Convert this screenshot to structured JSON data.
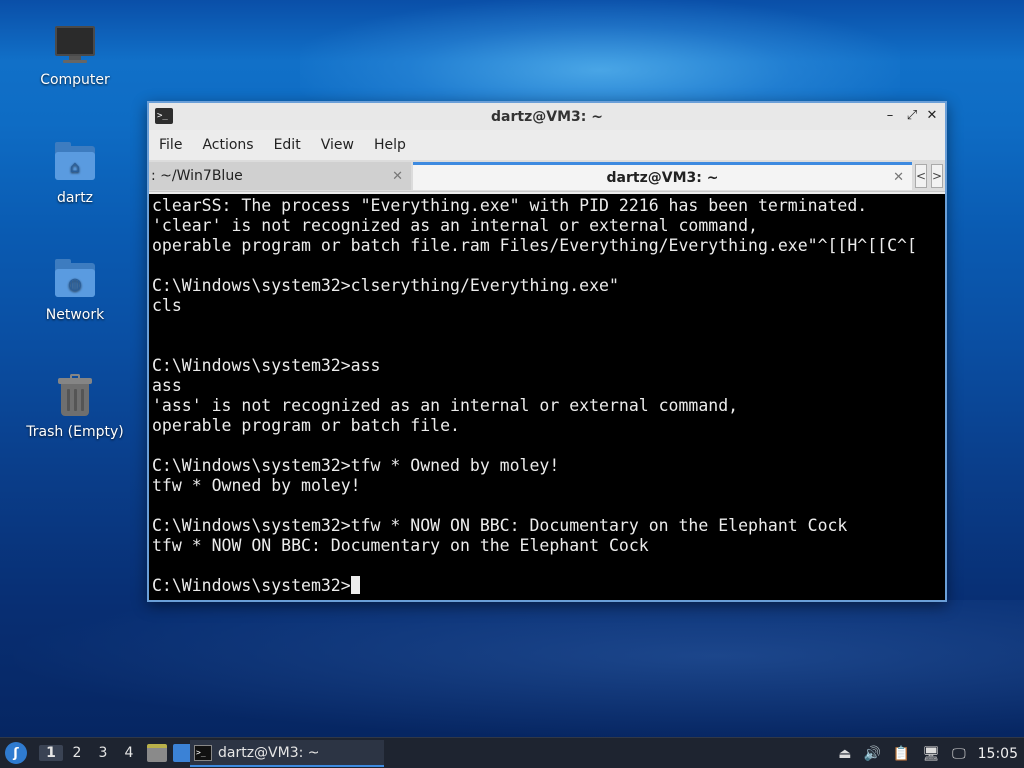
{
  "desktop": {
    "icons": [
      {
        "label": "Computer",
        "icon": "computer-icon"
      },
      {
        "label": "dartz",
        "icon": "home-folder-icon"
      },
      {
        "label": "Network",
        "icon": "network-folder-icon"
      },
      {
        "label": "Trash (Empty)",
        "icon": "trash-icon"
      }
    ]
  },
  "window": {
    "title": "dartz@VM3: ~",
    "menu": [
      "File",
      "Actions",
      "Edit",
      "View",
      "Help"
    ],
    "tabs": [
      {
        "label": ": ~/Win7Blue",
        "active": false
      },
      {
        "label": "dartz@VM3: ~",
        "active": true
      }
    ],
    "tab_scroll_left": "<",
    "tab_scroll_right": ">",
    "terminal_lines": [
      "clearSS: The process \"Everything.exe\" with PID 2216 has been terminated.",
      "'clear' is not recognized as an internal or external command,",
      "operable program or batch file.ram Files/Everything/Everything.exe\"^[[H^[[C^[",
      "",
      "C:\\Windows\\system32>clserything/Everything.exe\"",
      "cls",
      "",
      "",
      "C:\\Windows\\system32>ass",
      "ass",
      "'ass' is not recognized as an internal or external command,",
      "operable program or batch file.",
      "",
      "C:\\Windows\\system32>tfw * Owned by moley!",
      "tfw * Owned by moley!",
      "",
      "C:\\Windows\\system32>tfw * NOW ON BBC: Documentary on the Elephant Cock",
      "tfw * NOW ON BBC: Documentary on the Elephant Cock",
      "",
      "C:\\Windows\\system32>"
    ]
  },
  "taskbar": {
    "workspaces": [
      "1",
      "2",
      "3",
      "4"
    ],
    "active_workspace": "1",
    "task_label": "dartz@VM3: ~",
    "clock": "15:05"
  },
  "colors": {
    "accent": "#3d8ae0",
    "terminal_bg": "#000000",
    "terminal_fg": "#ececec",
    "taskbar_bg": "#1e2430"
  }
}
